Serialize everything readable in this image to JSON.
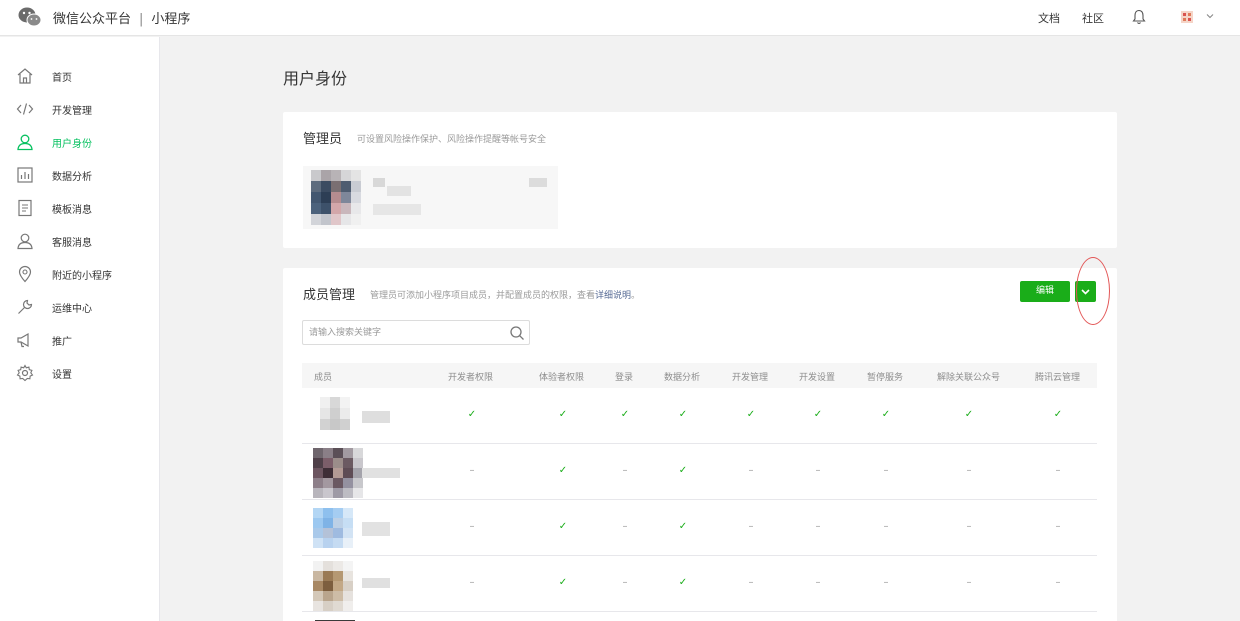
{
  "header": {
    "brand": "微信公众平台",
    "separator": "|",
    "product": "小程序",
    "docs": "文档",
    "community": "社区",
    "icons": [
      "wechat-logo-icon",
      "bell-icon",
      "avatar-icon",
      "chevron-down-icon"
    ]
  },
  "sidebar": {
    "items": [
      {
        "label": "首页",
        "icon": "home-icon",
        "active": false
      },
      {
        "label": "开发管理",
        "icon": "code-icon",
        "active": false
      },
      {
        "label": "用户身份",
        "icon": "user-icon",
        "active": true
      },
      {
        "label": "数据分析",
        "icon": "bar-chart-icon",
        "active": false
      },
      {
        "label": "模板消息",
        "icon": "document-icon",
        "active": false
      },
      {
        "label": "客服消息",
        "icon": "customer-service-icon",
        "active": false
      },
      {
        "label": "附近的小程序",
        "icon": "location-pin-icon",
        "active": false
      },
      {
        "label": "运维中心",
        "icon": "wrench-icon",
        "active": false
      },
      {
        "label": "推广",
        "icon": "megaphone-icon",
        "active": false
      },
      {
        "label": "设置",
        "icon": "gear-icon",
        "active": false
      }
    ]
  },
  "page": {
    "title": "用户身份"
  },
  "admin": {
    "title": "管理员",
    "desc": "可设置风险操作保护、风险操作提醒等帐号安全"
  },
  "members": {
    "title": "成员管理",
    "desc": "管理员可添加小程序项目成员，并配置成员的权限，查看",
    "desc_link": "详细说明",
    "desc_end": "。",
    "edit_button": "编辑",
    "search_placeholder": "请输入搜索关键字",
    "search_value": "",
    "columns": [
      "成员",
      "开发者权限",
      "体验者权限",
      "登录",
      "数据分析",
      "开发管理",
      "开发设置",
      "暂停服务",
      "解除关联公众号",
      "腾讯云管理"
    ],
    "rows": [
      {
        "perms": [
          "✓",
          "✓",
          "✓",
          "✓",
          "✓",
          "✓",
          "✓",
          "✓",
          "✓"
        ]
      },
      {
        "perms": [
          "–",
          "✓",
          "–",
          "✓",
          "–",
          "–",
          "–",
          "–",
          "–"
        ]
      },
      {
        "perms": [
          "–",
          "✓",
          "–",
          "✓",
          "–",
          "–",
          "–",
          "–",
          "–"
        ]
      },
      {
        "perms": [
          "–",
          "✓",
          "–",
          "✓",
          "–",
          "–",
          "–",
          "–",
          "–"
        ]
      }
    ]
  },
  "colors": {
    "accent": "#1aad19",
    "active_nav": "#07c160",
    "link": "#576b95",
    "annotation": "#e35757"
  }
}
